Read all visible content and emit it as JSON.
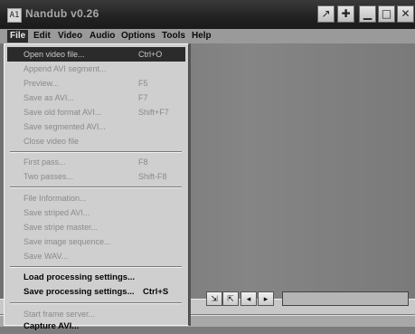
{
  "window": {
    "title": "Nandub v0.26",
    "app_icon_glyph": "A1",
    "buttons": [
      {
        "name": "arrow-diagonal-icon",
        "glyph": "↗"
      },
      {
        "name": "move-icon",
        "glyph": "✚"
      },
      {
        "name": "minimize-icon",
        "glyph": "▁"
      },
      {
        "name": "maximize-icon",
        "glyph": "□"
      },
      {
        "name": "close-icon",
        "glyph": "✕"
      }
    ]
  },
  "menubar": [
    "File",
    "Edit",
    "Video",
    "Audio",
    "Options",
    "Tools",
    "Help"
  ],
  "file_menu": {
    "open_video": {
      "label": "Open video file...",
      "shortcut": "Ctrl+O"
    },
    "append_avi": {
      "label": "Append AVI segment..."
    },
    "preview": {
      "label": "Preview...",
      "shortcut": "F5"
    },
    "save_as_avi": {
      "label": "Save as AVI...",
      "shortcut": "F7"
    },
    "save_old_format": {
      "label": "Save old format AVI...",
      "shortcut": "Shift+F7"
    },
    "save_segmented": {
      "label": "Save segmented AVI..."
    },
    "close_video": {
      "label": "Close video file"
    },
    "first_pass": {
      "label": "First pass...",
      "shortcut": "F8"
    },
    "two_passes": {
      "label": "Two passes...",
      "shortcut": "Shift-F8"
    },
    "file_information": {
      "label": "File Information..."
    },
    "save_striped": {
      "label": "Save striped AVI..."
    },
    "save_stripe_master": {
      "label": "Save stripe master..."
    },
    "save_image_sequence": {
      "label": "Save image sequence..."
    },
    "save_wav": {
      "label": "Save WAV..."
    },
    "load_processing": {
      "label": "Load processing settings..."
    },
    "save_processing": {
      "label": "Save processing settings...",
      "shortcut": "Ctrl+S"
    },
    "start_frame_server": {
      "label": "Start frame server..."
    },
    "capture_avi": {
      "label": "Capture AVI..."
    }
  },
  "controls": {
    "mark_in_glyph": "⇲",
    "mark_out_glyph": "⇱",
    "prev_key_glyph": "◂",
    "next_key_glyph": "▸"
  }
}
